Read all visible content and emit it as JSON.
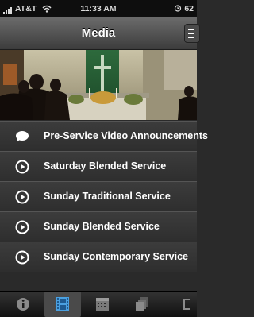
{
  "status": {
    "carrier": "AT&T",
    "time": "11:33 AM",
    "battery": "62"
  },
  "nav": {
    "title": "Media"
  },
  "list": {
    "items": [
      {
        "label": "Pre-Service Video Announcements",
        "icon": "speech-bubble-icon"
      },
      {
        "label": "Saturday Blended Service",
        "icon": "play-circle-icon"
      },
      {
        "label": "Sunday Traditional Service",
        "icon": "play-circle-icon"
      },
      {
        "label": "Sunday Blended Service",
        "icon": "play-circle-icon"
      },
      {
        "label": "Sunday Contemporary Service",
        "icon": "play-circle-icon"
      }
    ]
  },
  "tabs": [
    {
      "icon": "info-icon",
      "active": false
    },
    {
      "icon": "film-icon",
      "active": true
    },
    {
      "icon": "calendar-icon",
      "active": false
    },
    {
      "icon": "stack-icon",
      "active": false
    },
    {
      "icon": "more-icon",
      "active": false
    }
  ],
  "colors": {
    "nav_top": "#6b6b6b",
    "nav_bottom": "#3c3c3c",
    "row_bg": "#333333",
    "text": "#ffffff"
  }
}
